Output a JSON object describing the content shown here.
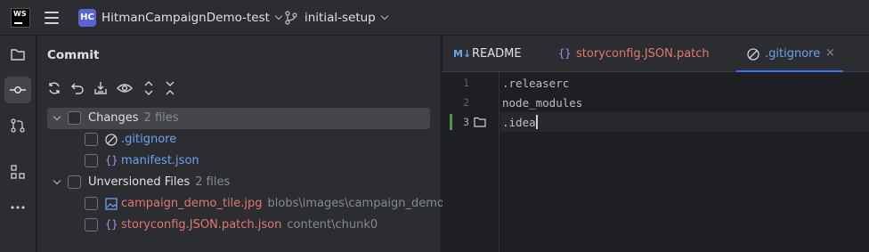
{
  "titlebar": {
    "logo_text": "WS",
    "project_badge": "HC",
    "project_name": "HitmanCampaignDemo-test",
    "branch_name": "initial-setup"
  },
  "left_toolbar": {
    "items": [
      "folder-icon",
      "commit-icon",
      "pull-requests-icon",
      "structure-icon",
      "more-icon"
    ]
  },
  "commit_panel": {
    "title": "Commit",
    "toolbar_icons": [
      "refresh-icon",
      "rollback-icon",
      "shelve-icon",
      "eye-icon",
      "expand-all-icon",
      "collapse-all-icon"
    ],
    "groups": [
      {
        "label": "Changes",
        "count": "2 files",
        "files": [
          {
            "name": ".gitignore",
            "path": "",
            "color": "#6ea1f2",
            "icon": "ignore-file-icon"
          },
          {
            "name": "manifest.json",
            "path": "",
            "color": "#6ea1f2",
            "icon": "json-icon"
          }
        ]
      },
      {
        "label": "Unversioned Files",
        "count": "2 files",
        "files": [
          {
            "name": "campaign_demo_tile.jpg",
            "path": "blobs\\images\\campaign_demo",
            "color": "#e57575",
            "icon": "image-icon"
          },
          {
            "name": "storyconfig.JSON.patch.json",
            "path": "content\\chunk0",
            "color": "#e57575",
            "icon": "json-icon"
          }
        ]
      }
    ]
  },
  "editor": {
    "tabs": [
      {
        "icon_text": "M↓",
        "label": "README",
        "color": "#dfe1e5"
      },
      {
        "icon_text": "{}",
        "label": "storyconfig.JSON.patch",
        "color": "#e57575"
      },
      {
        "icon_text": "",
        "label": ".gitignore",
        "color": "#6ea1f2"
      }
    ],
    "close_glyph": "×",
    "lines": [
      {
        "num": "1",
        "text": ".releaserc"
      },
      {
        "num": "2",
        "text": "node_modules"
      },
      {
        "num": "3",
        "text": ".idea"
      }
    ]
  },
  "colors": {
    "accent": "#3574f0",
    "added": "#549159",
    "unversioned": "#e57575",
    "modified": "#6ea1f2"
  }
}
